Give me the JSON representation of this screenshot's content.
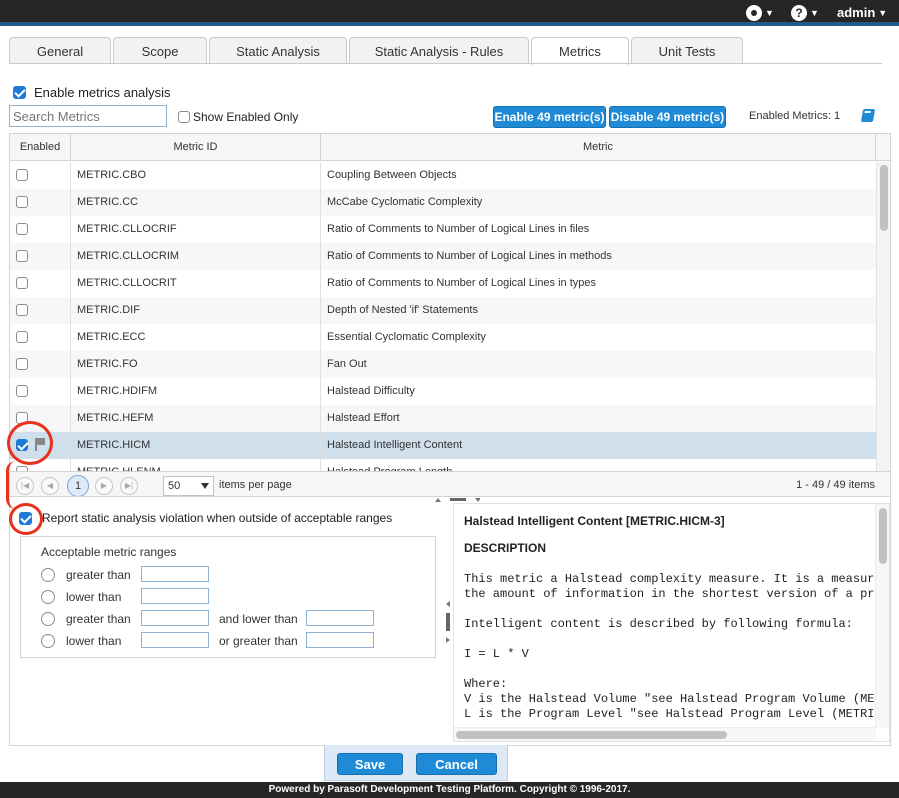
{
  "topbar": {
    "user": "admin"
  },
  "tabs": [
    "General",
    "Scope",
    "Static Analysis",
    "Static Analysis - Rules",
    "Metrics",
    "Unit Tests"
  ],
  "active_tab": "Metrics",
  "enable_metrics_label": "Enable metrics analysis",
  "search": {
    "placeholder": "Search Metrics"
  },
  "show_enabled_label": "Show Enabled Only",
  "enable_button": "Enable 49 metric(s)",
  "disable_button": "Disable 49 metric(s)",
  "enabled_metrics": "Enabled Metrics: 1",
  "grid": {
    "headers": [
      "Enabled",
      "Metric ID",
      "Metric"
    ],
    "rows": [
      {
        "id": "METRIC.CBO",
        "name": "Coupling Between Objects",
        "enabled": false
      },
      {
        "id": "METRIC.CC",
        "name": "McCabe Cyclomatic Complexity",
        "enabled": false
      },
      {
        "id": "METRIC.CLLOCRIF",
        "name": "Ratio of Comments to Number of Logical Lines in files",
        "enabled": false
      },
      {
        "id": "METRIC.CLLOCRIM",
        "name": "Ratio of Comments to Number of Logical Lines in methods",
        "enabled": false
      },
      {
        "id": "METRIC.CLLOCRIT",
        "name": "Ratio of Comments to Number of Logical Lines in types",
        "enabled": false
      },
      {
        "id": "METRIC.DIF",
        "name": "Depth of Nested 'if' Statements",
        "enabled": false
      },
      {
        "id": "METRIC.ECC",
        "name": "Essential Cyclomatic Complexity",
        "enabled": false
      },
      {
        "id": "METRIC.FO",
        "name": "Fan Out",
        "enabled": false
      },
      {
        "id": "METRIC.HDIFM",
        "name": "Halstead Difficulty",
        "enabled": false
      },
      {
        "id": "METRIC.HEFM",
        "name": "Halstead Effort",
        "enabled": false
      },
      {
        "id": "METRIC.HICM",
        "name": "Halstead Intelligent Content",
        "enabled": true
      },
      {
        "id": "METRIC.HLENM",
        "name": "Halstead Program Length",
        "enabled": false
      }
    ]
  },
  "pager": {
    "current": "1",
    "page_size": "50",
    "per_page_label": "items per page",
    "info": "1 - 49 / 49 items"
  },
  "report_label": "Report static analysis violation when outside of acceptable ranges",
  "ranges": {
    "title": "Acceptable metric ranges",
    "rows": [
      {
        "label": "greater than",
        "label2": ""
      },
      {
        "label": "lower than",
        "label2": ""
      },
      {
        "label": "greater than",
        "label2": "and lower than"
      },
      {
        "label": "lower than",
        "label2": "or greater than"
      }
    ]
  },
  "description": {
    "title": "Halstead Intelligent Content [METRIC.HICM-3]",
    "heading": "DESCRIPTION",
    "line1": "This metric a Halstead complexity measure. It is a measure of",
    "line2": "the amount of information in the shortest version of a program",
    "line3": "Intelligent content is described by following formula:",
    "line4": "I = L * V",
    "line5": "Where:",
    "line6": "V is the Halstead Volume \"see Halstead Program Volume (METRIC.H",
    "line7": "L is the Program Level \"see Halstead Program Level (METRIC.HLEV"
  },
  "save_label": "Save",
  "cancel_label": "Cancel",
  "footer": "Powered by Parasoft Development Testing Platform. Copyright © 1996-2017.",
  "colors": {
    "accent": "#1f8ad6",
    "annotation": "#e8321e",
    "topbar": "#262626",
    "selected_row": "#cfdfec"
  }
}
